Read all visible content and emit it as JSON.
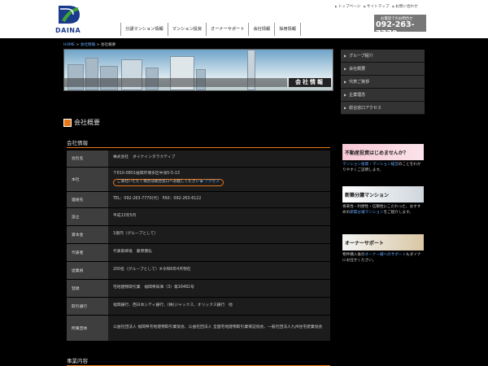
{
  "header": {
    "logo_text": "DAINA",
    "nav": [
      "分譲マンション情報",
      "マンション投資",
      "オーナーサポート",
      "会社情報",
      "採用情報"
    ],
    "util_links": [
      "トップページ",
      "サイトマップ",
      "お問い合わせ"
    ],
    "tel_label": "お電話でのお問合せ",
    "tel_number": "092-263-7770"
  },
  "breadcrumb": {
    "home": "HOME",
    "sep1": " > ",
    "company": "会社情報",
    "sep2": " > ",
    "current": "会社概要"
  },
  "banner": {
    "title": "会社情報"
  },
  "section": {
    "title": "会社概要",
    "subtitle": "会社情報"
  },
  "table": [
    {
      "label": "会社名",
      "value": "株式会社　ダイナインタラクティブ"
    },
    {
      "label": "本社",
      "value": "〒810-0801福岡市博多区中洲5-5-13",
      "pill_text": "ご来社いただく場合は総合窓口へお越しください",
      "pill_link": "アクセス"
    },
    {
      "label": "連絡先",
      "value": "TEL：092-263-7770(代)　FAX：092-263-6122"
    },
    {
      "label": "設立",
      "value": "平成13年5月"
    },
    {
      "label": "資本金",
      "value": "1億円（グループとして）"
    },
    {
      "label": "代表者",
      "value": "代表取締役　藤原康弘"
    },
    {
      "label": "従業員",
      "value": "200名（グループとして）※令和6年4月現在"
    },
    {
      "label": "登録",
      "value": "宅地建物取引業　福岡県知事（3）第16482号"
    },
    {
      "label": "取引銀行",
      "value": "福岡銀行、西日本シティ銀行、(株)ジャックス、オリックス銀行　他"
    },
    {
      "label": "所属団体",
      "value": "公益社団法人 福岡県宅地建物取引業協会、公益社団法人 全国宅地建物取引業保証協会、一般社団法人九州住宅産業協会"
    }
  ],
  "section2": {
    "title": "事業内容"
  },
  "sidebar": [
    "グループ紹介",
    "会社概要",
    "代表ご挨拶",
    "企業理念",
    "総合窓口アクセス"
  ],
  "promos": [
    {
      "banner": "不動産投資はじめませんか？",
      "link": "マンション投資・マンション経営",
      "text": "のことをわかりやすくご説明します。"
    },
    {
      "banner": "新築分譲マンション",
      "text1": "将来性・利便性・信頼性にこだわった、おすすめの",
      "link": "新築分譲マンション",
      "text2": "をご紹介します。"
    },
    {
      "banner": "オーナーサポート",
      "text1": "物件購入後の",
      "link": "オーナー様へのサポート",
      "text2": "もダイナにお任せください。"
    }
  ],
  "colors": {
    "accent": "#e87817",
    "link": "#66aaff",
    "brand": "#1a3a8a"
  }
}
